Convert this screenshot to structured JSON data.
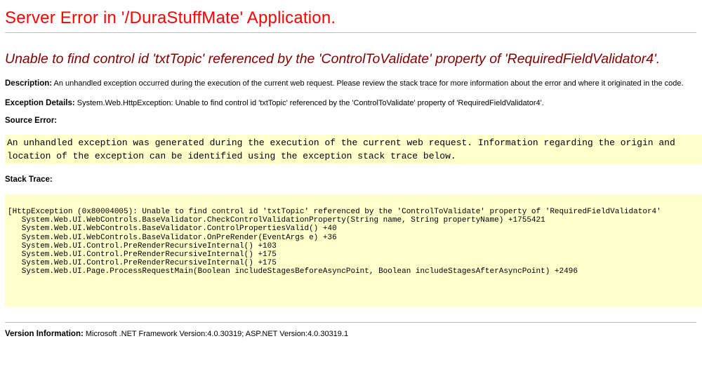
{
  "page_title": "Server Error in '/DuraStuffMate' Application.",
  "error_message": "Unable to find control id 'txtTopic' referenced by the 'ControlToValidate' property of 'RequiredFieldValidator4'.",
  "description": {
    "label": "Description:",
    "text": "An unhandled exception occurred during the execution of the current web request. Please review the stack trace for more information about the error and where it originated in the code."
  },
  "exception_details": {
    "label": "Exception Details:",
    "text": "System.Web.HttpException: Unable to find control id 'txtTopic' referenced by the 'ControlToValidate' property of 'RequiredFieldValidator4'."
  },
  "source_error": {
    "label": "Source Error:",
    "lines": [
      "An unhandled exception was generated during the execution of the current web request. Information regarding the origin and",
      "location of the exception can be identified using the exception stack trace below."
    ]
  },
  "stack_trace": {
    "label": "Stack Trace:",
    "lines": [
      "[HttpException (0x80004005): Unable to find control id 'txtTopic' referenced by the 'ControlToValidate' property of 'RequiredFieldValidator4'",
      "   System.Web.UI.WebControls.BaseValidator.CheckControlValidationProperty(String name, String propertyName) +1755421",
      "   System.Web.UI.WebControls.BaseValidator.ControlPropertiesValid() +40",
      "   System.Web.UI.WebControls.BaseValidator.OnPreRender(EventArgs e) +36",
      "   System.Web.UI.Control.PreRenderRecursiveInternal() +103",
      "   System.Web.UI.Control.PreRenderRecursiveInternal() +175",
      "   System.Web.UI.Control.PreRenderRecursiveInternal() +175",
      "   System.Web.UI.Page.ProcessRequestMain(Boolean includeStagesBeforeAsyncPoint, Boolean includeStagesAfterAsyncPoint) +2496"
    ]
  },
  "version_info": {
    "label": "Version Information:",
    "text": "Microsoft .NET Framework Version:4.0.30319; ASP.NET Version:4.0.30319.1"
  },
  "colors": {
    "title": "#ff0000",
    "error_message": "#800000",
    "code_background": "#ffffcc",
    "rule": "#c0c0c0"
  }
}
